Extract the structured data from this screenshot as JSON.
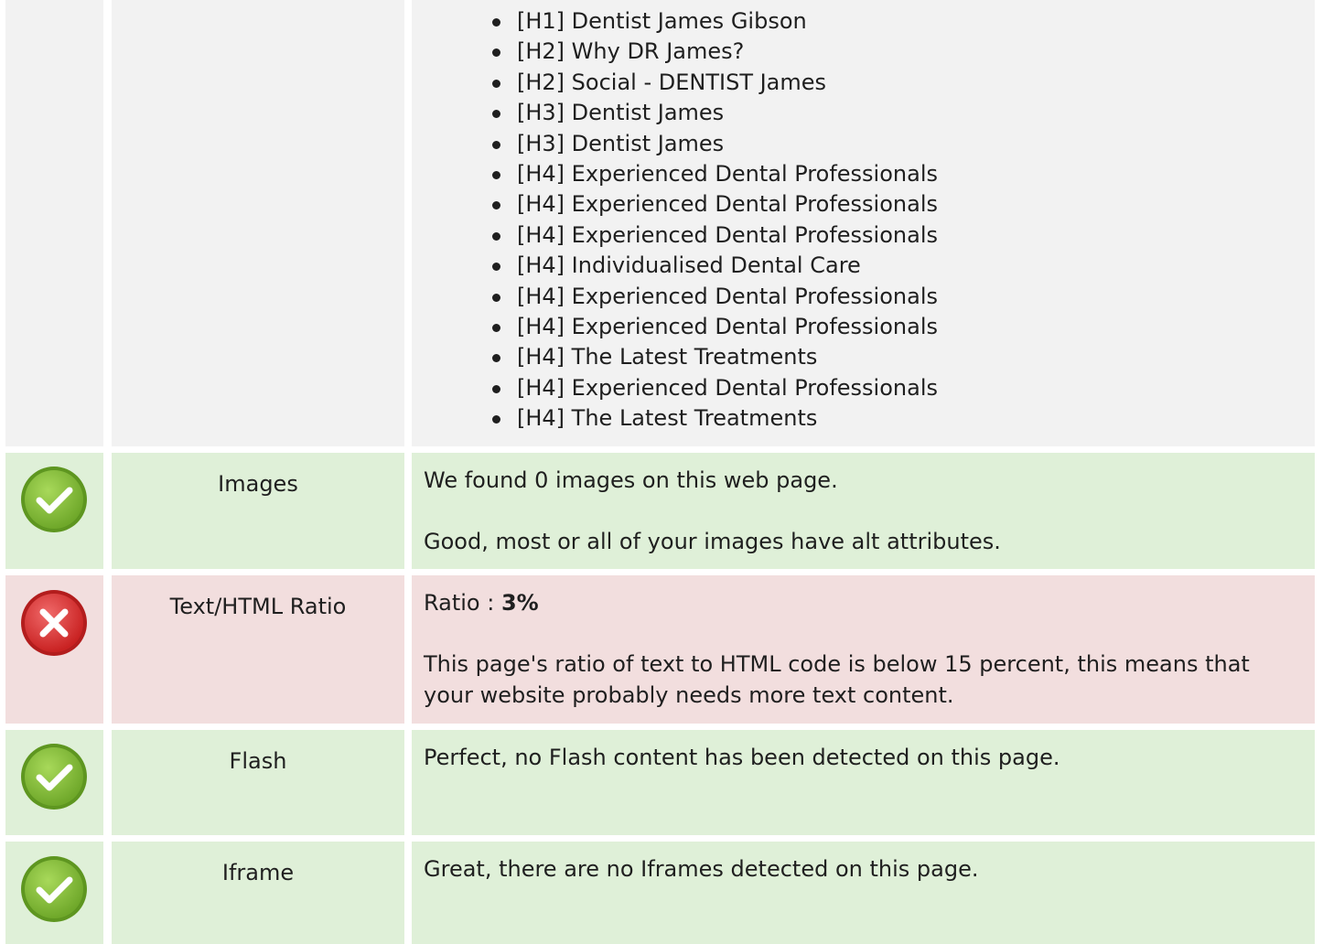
{
  "headings": {
    "items": [
      "[H1] Dentist James Gibson",
      "[H2] Why DR James?",
      "[H2] Social - DENTIST James",
      "[H3] Dentist James",
      "[H3] Dentist James",
      "[H4] Experienced Dental Professionals",
      "[H4] Experienced Dental Professionals",
      "[H4] Experienced Dental Professionals",
      "[H4] Individualised Dental Care",
      "[H4] Experienced Dental Professionals",
      "[H4] Experienced Dental Professionals",
      "[H4] The Latest Treatments",
      "[H4] Experienced Dental Professionals",
      "[H4] The Latest Treatments"
    ]
  },
  "checks": {
    "images": {
      "status": "pass",
      "label": "Images",
      "line1": "We found 0 images on this web page.",
      "line2": "Good, most or all of your images have alt attributes."
    },
    "ratio": {
      "status": "fail",
      "label": "Text/HTML Ratio",
      "prefix": "Ratio : ",
      "value": "3%",
      "line2": "This page's ratio of text to HTML code is below 15 percent, this means that your website probably needs more text content."
    },
    "flash": {
      "status": "pass",
      "label": "Flash",
      "line1": "Perfect, no Flash content has been detected on this page."
    },
    "iframe": {
      "status": "pass",
      "label": "Iframe",
      "line1": "Great, there are no Iframes detected on this page."
    }
  },
  "icons": {
    "pass": "check-icon",
    "fail": "cross-icon"
  },
  "colors": {
    "pass_bg": "#dff0d8",
    "fail_bg": "#f2dede",
    "neutral_bg": "#f2f2f2",
    "pass_icon": "#8cc63f",
    "fail_icon": "#e23c3c"
  }
}
